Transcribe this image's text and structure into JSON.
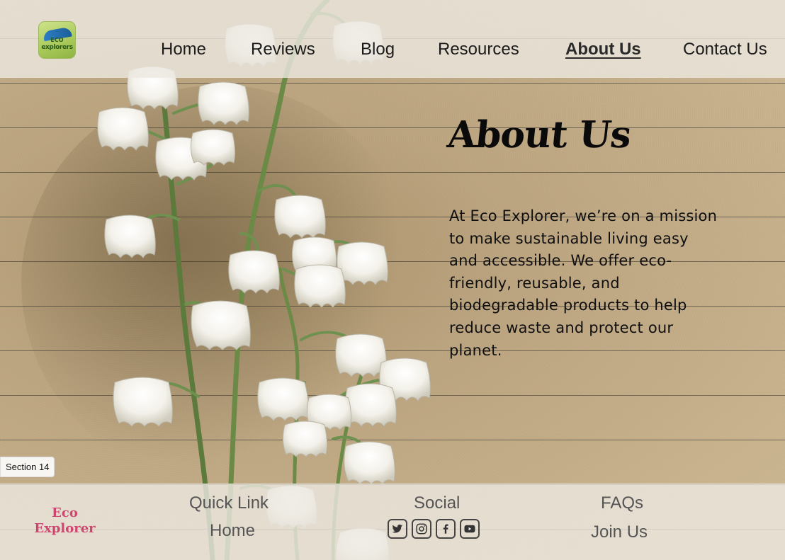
{
  "header": {
    "logo": {
      "line1": "ECO",
      "line2": "explorers"
    },
    "nav": [
      {
        "label": "Home",
        "active": false
      },
      {
        "label": "Reviews",
        "active": false
      },
      {
        "label": "Blog",
        "active": false
      },
      {
        "label": "Resources",
        "active": false
      },
      {
        "label": "About Us",
        "active": true
      },
      {
        "label": "Contact Us",
        "active": false
      }
    ]
  },
  "main": {
    "title": "About Us",
    "paragraph": "At Eco Explorer, we’re on a mission to make sustainable living easy and accessible. We offer eco-friendly, reusable, and biodegradable products to help reduce waste and protect our planet."
  },
  "section_tag": "Section 14",
  "footer": {
    "brand_line1": "Eco",
    "brand_line2": "Explorer",
    "quick_link_heading": "Quick Link",
    "quick_links": [
      "Home"
    ],
    "social_heading": "Social",
    "social_icons": [
      "twitter-icon",
      "instagram-icon",
      "facebook-icon",
      "youtube-icon"
    ],
    "faqs_heading": "FAQs",
    "join_label": "Join Us"
  },
  "colors": {
    "brand_pink": "#d0456f",
    "nav_text": "#1b1b1b",
    "overlay": "#ece8e1"
  }
}
